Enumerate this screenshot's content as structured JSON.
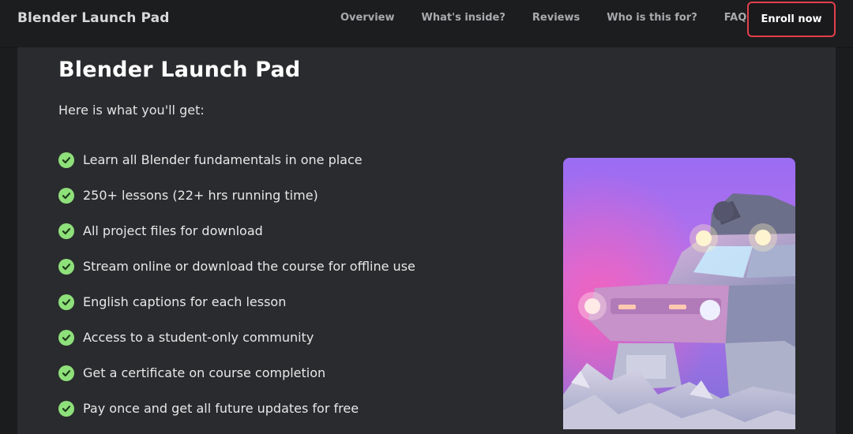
{
  "nav": {
    "brand": "Blender Launch Pad",
    "links": [
      {
        "label": "Overview"
      },
      {
        "label": "What's inside?"
      },
      {
        "label": "Reviews"
      },
      {
        "label": "Who is this for?"
      },
      {
        "label": "FAQ"
      }
    ],
    "enroll_label": "Enroll now"
  },
  "main": {
    "title": "Blender Launch Pad",
    "subtitle": "Here is what you'll get:",
    "features": [
      {
        "text": "Learn all Blender fundamentals in one place"
      },
      {
        "text": "250+ lessons (22+ hrs running time)"
      },
      {
        "text": "All project files for download"
      },
      {
        "text": "Stream online or download the course for offline use"
      },
      {
        "text": "English captions for each lesson"
      },
      {
        "text": "Access to a student-only community"
      },
      {
        "text": "Get a certificate on course completion"
      },
      {
        "text": "Pay once and get all future updates for free"
      }
    ],
    "hero_image_icon": "stylized-truck-render-image"
  },
  "colors": {
    "accent_border": "#e2404b",
    "check": "#8ee07a",
    "card_bg": "#2a2b2e",
    "nav_bg": "#1c1d1f"
  }
}
